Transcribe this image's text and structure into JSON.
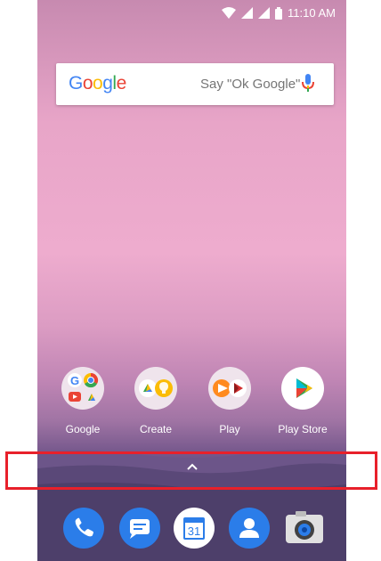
{
  "status_bar": {
    "time": "11:10 AM",
    "icons": [
      "wifi-icon",
      "signal-icon",
      "signal-icon",
      "battery-icon"
    ]
  },
  "search_widget": {
    "logo_text": "Google",
    "hint_text": "Say \"Ok Google\"",
    "icon": "microphone-icon"
  },
  "home_apps": [
    {
      "label": "Google",
      "icon": "google-folder-icon"
    },
    {
      "label": "Create",
      "icon": "create-folder-icon"
    },
    {
      "label": "Play",
      "icon": "play-folder-icon"
    },
    {
      "label": "Play Store",
      "icon": "play-store-icon"
    }
  ],
  "app_drawer_handle": {
    "icon": "chevron-up-icon"
  },
  "dock": [
    {
      "icon": "phone-icon"
    },
    {
      "icon": "messages-icon"
    },
    {
      "icon": "calendar-icon",
      "text": "31"
    },
    {
      "icon": "contacts-icon"
    },
    {
      "icon": "camera-icon"
    }
  ],
  "colors": {
    "highlight": "#e8202a",
    "google_blue": "#4285f4",
    "google_red": "#ea4335",
    "google_yellow": "#fbbc05",
    "google_green": "#34a853"
  }
}
